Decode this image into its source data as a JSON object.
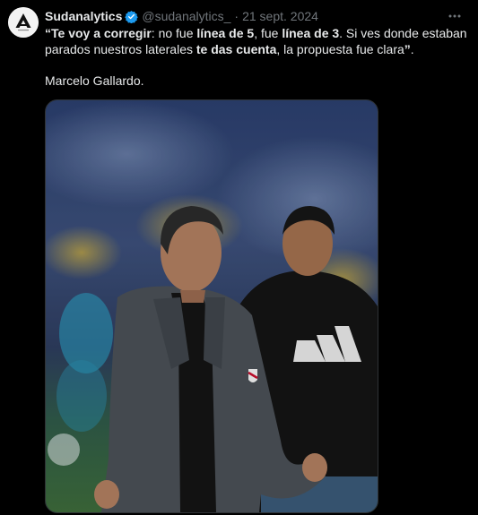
{
  "tweet": {
    "author_name": "Sudanalytics",
    "handle": "@sudanalytics_",
    "separator": "·",
    "date": "21 sept. 2024",
    "more_icon": "more-horizontal-icon",
    "verified_icon": "verified-badge-icon",
    "text": {
      "q_open": "“",
      "bold_1": "Te voy a corregir",
      "part_2": ": no fue ",
      "bold_3": "línea de 5",
      "part_4": ", fue ",
      "bold_5": "línea de 3",
      "part_6": ". Si ves donde estaban parados nuestros laterales ",
      "bold_7": "te das cuenta",
      "part_8": ", la propuesta fue clara",
      "q_close": "”",
      "part_9": ".",
      "signature": "Marcelo Gallardo."
    },
    "colors": {
      "background": "#000000",
      "verified": "#1d9bf0",
      "secondary_text": "#71767b"
    }
  }
}
